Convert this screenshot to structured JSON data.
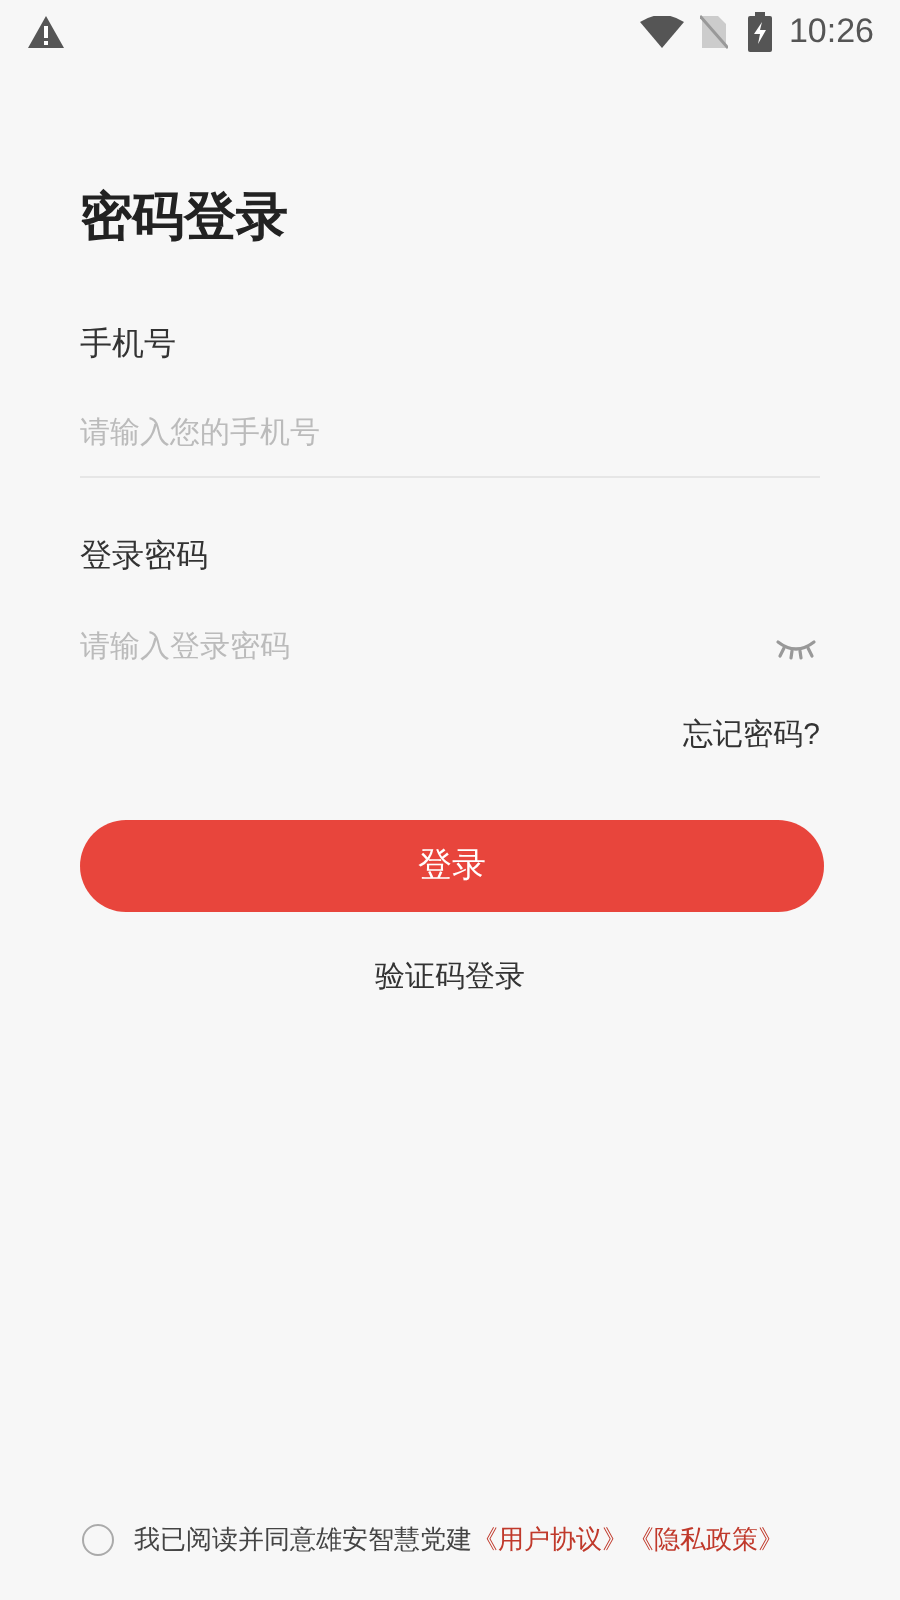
{
  "status_bar": {
    "time": "10:26"
  },
  "title": "密码登录",
  "fields": [
    {
      "label": "手机号",
      "placeholder": "请输入您的手机号",
      "kind": "text"
    },
    {
      "label": "登录密码",
      "placeholder": "请输入登录密码",
      "kind": "password"
    }
  ],
  "forgot_link": "忘记密码?",
  "login_button": "登录",
  "alt_login": "验证码登录",
  "agreement": {
    "checked": false,
    "text": "我已阅读并同意雄安智慧党建",
    "links": [
      "《用户协议》",
      "《隐私政策》"
    ]
  }
}
